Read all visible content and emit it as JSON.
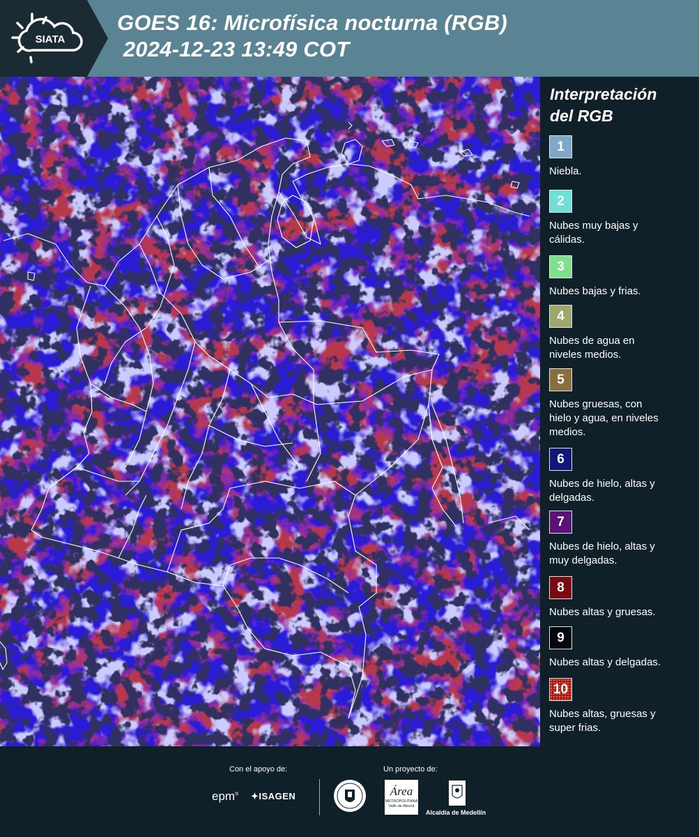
{
  "header": {
    "logo_text": "SIATA",
    "title_line1": "GOES 16: Microfísica nocturna (RGB)",
    "title_line2": " 2024-12-23 13:49 COT",
    "background_color": "#5a8394"
  },
  "legend": {
    "title_line1": "Interpretación",
    "title_line2": "del RGB",
    "items": [
      {
        "number": "1",
        "color": "#7fa7c8",
        "text_line1": "Niebla.",
        "text_line2": ""
      },
      {
        "number": "2",
        "color": "#6fe0d6",
        "text_line1": "Nubes muy bajas y",
        "text_line2": "cálidas."
      },
      {
        "number": "3",
        "color": "#7fe08a",
        "text_line1": "Nubes bajas y frias.",
        "text_line2": ""
      },
      {
        "number": "4",
        "color": "#9fa86a",
        "text_line1": "Nubes de agua en",
        "text_line2": "niveles medios."
      },
      {
        "number": "5",
        "color": "#8a6e3e",
        "text_line1": "Nubes gruesas, con",
        "text_line2": "hielo y agua, en niveles",
        "text_line3": "medios."
      },
      {
        "number": "6",
        "color": "#12157a",
        "text_line1": "Nubes de hielo, altas y",
        "text_line2": "delgadas."
      },
      {
        "number": "7",
        "color": "#5a1278",
        "text_line1": "Nubes de hielo, altas y",
        "text_line2": "muy delgadas."
      },
      {
        "number": "8",
        "color": "#7a0a10",
        "text_line1": "Nubes altas y gruesas.",
        "text_line2": ""
      },
      {
        "number": "9",
        "color": "#05060e",
        "text_line1": "Nubes altas y delgadas.",
        "text_line2": ""
      },
      {
        "number": "10",
        "color": "#a01818",
        "text_line1": "Nubes altas, gruesas y",
        "text_line2": "super frias."
      }
    ]
  },
  "footer": {
    "support_label": "Con el apoyo de:",
    "support_logo1": "epm",
    "support_logo2": "ISAGEN",
    "project_label": "Un proyecto de:",
    "metro_logo_text": "Área",
    "metro_logo_sub1": "METROPOLITANA",
    "metro_logo_sub2": "Valle de Aburrá",
    "alcaldia_text": "Alcaldía de Medellín"
  },
  "map": {
    "ocean_color": "#2a1ad0",
    "cloud_color": "#7a0a10",
    "border_color": "#ffffff"
  }
}
